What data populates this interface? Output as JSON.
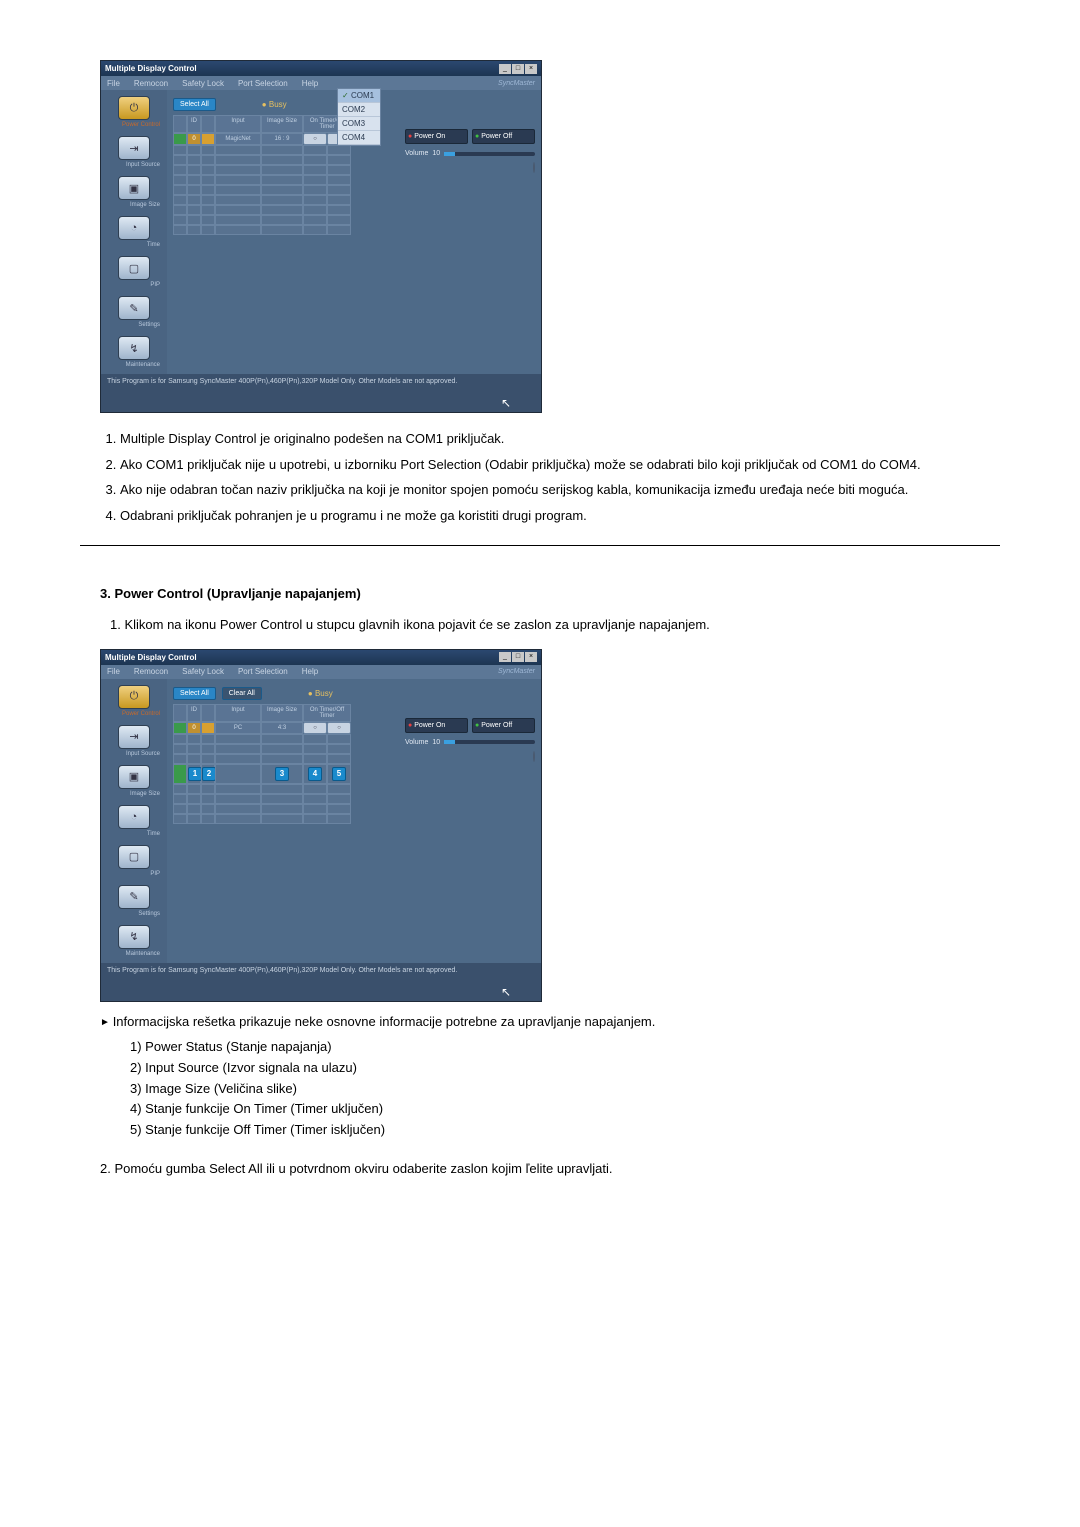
{
  "app": {
    "title": "Multiple Display Control",
    "menu": [
      "File",
      "Remocon",
      "Safety Lock",
      "Port Selection",
      "Help"
    ],
    "logo": "SyncMaster",
    "port_options": [
      "COM1",
      "COM2",
      "COM3",
      "COM4"
    ],
    "busy": "Busy",
    "footer": "This Program is for Samsung SyncMaster 400P(Pn),460P(Pn),320P Model Only. Other Models are not approved."
  },
  "sidebar": [
    {
      "label": "Power Control",
      "glyph": "⏻"
    },
    {
      "label": "Input Source",
      "glyph": "⇥"
    },
    {
      "label": "Image Size",
      "glyph": "▣"
    },
    {
      "label": "Time",
      "glyph": "◔"
    },
    {
      "label": "PIP",
      "glyph": "▢"
    },
    {
      "label": "Settings",
      "glyph": "✎"
    },
    {
      "label": "Maintenance",
      "glyph": "↯"
    }
  ],
  "buttons": {
    "select_all": "Select All",
    "clear_all": "Clear All",
    "power_on": "Power On",
    "power_off": "Power Off",
    "volume_label": "Volume",
    "volume_value": "10"
  },
  "grid1": {
    "headers": [
      "",
      "ID",
      "",
      "Input",
      "Image Size",
      "On Timer/Off Timer"
    ],
    "row": {
      "id": "0",
      "input": "MagicNet",
      "size": "16 : 9",
      "on": "○",
      "off": "○"
    }
  },
  "grid2": {
    "headers": [
      "",
      "ID",
      "",
      "Input",
      "Image Size",
      "On Timer/Off Timer"
    ],
    "row": {
      "id": "0",
      "input": "PC",
      "size": "4:3",
      "on": "○",
      "off": "○"
    },
    "badges": [
      "1",
      "2",
      "3",
      "4",
      "5"
    ]
  },
  "doc": {
    "list1": [
      "Multiple Display Control je originalno podešen na COM1 priključak.",
      "Ako COM1 priključak nije u upotrebi, u izborniku Port Selection (Odabir priključka) može se odabrati bilo koji priključak od COM1 do COM4.",
      "Ako nije odabran točan naziv priključka na koji je monitor spojen pomoću serijskog kabla, komunikacija između uređaja neće biti moguća.",
      "Odabrani priključak pohranjen je u programu i ne može ga koristiti drugi program."
    ],
    "section2_title": "3. Power Control (Upravljanje napajanjem)",
    "section2_intro": "1.  Klikom na ikonu Power Control u stupcu glavnih ikona pojavit će se zaslon za upravljanje napajanjem.",
    "bullet": "Informacijska rešetka prikazuje neke osnovne informacije potrebne za upravljanje napajanjem.",
    "sublist": [
      "1) Power Status (Stanje napajanja)",
      "2) Input Source (Izvor signala na ulazu)",
      "3) Image Size (Veličina slike)",
      "4) Stanje funkcije On Timer (Timer uključen)",
      "5) Stanje funkcije Off Timer (Timer isključen)"
    ],
    "closing": "2.  Pomoću gumba Select All ili u potvrdnom okviru odaberite zaslon kojim ľelite upravljati."
  }
}
